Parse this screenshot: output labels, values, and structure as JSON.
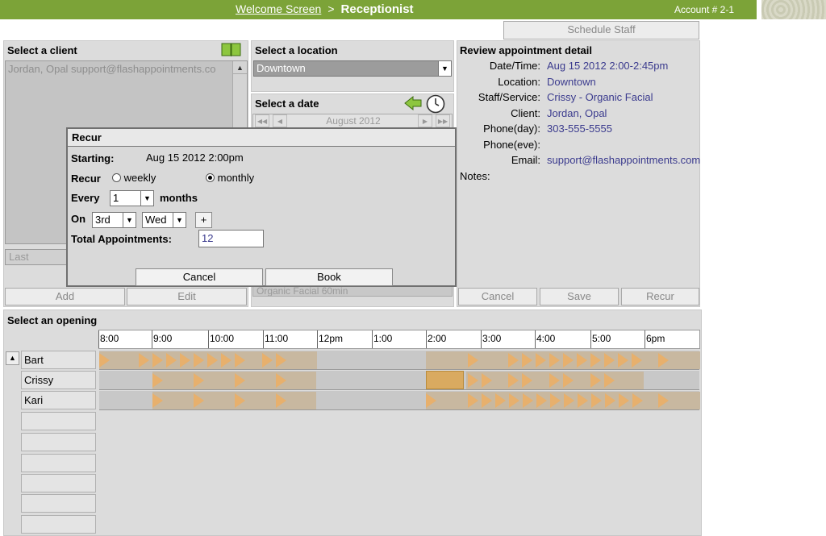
{
  "topbar": {
    "breadcrumb_link": "Welcome Screen",
    "separator": ">",
    "current": "Receptionist",
    "account": "Account # 2-1"
  },
  "schedule_staff_label": "Schedule Staff",
  "client_panel": {
    "title": "Select a client",
    "selected_client": "Jordan, Opal support@flashappointments.co",
    "last_placeholder": "Last",
    "add_label": "Add",
    "edit_label": "Edit",
    "book_icon": "book-icon"
  },
  "location_panel": {
    "title": "Select a location",
    "selected": "Downtown"
  },
  "date_panel": {
    "title": "Select a date",
    "month_label": "August  2012",
    "back_icon": "arrow-left-icon",
    "clock_icon": "clock-icon",
    "service_partial": "Organic Facial 60min"
  },
  "detail_panel": {
    "title": "Review appointment detail",
    "labels": {
      "datetime": "Date/Time:",
      "location": "Location:",
      "staff": "Staff/Service:",
      "client": "Client:",
      "phone_day": "Phone(day):",
      "phone_eve": "Phone(eve):",
      "email": "Email:",
      "notes": "Notes:"
    },
    "values": {
      "datetime": "Aug 15 2012 2:00-2:45pm",
      "location": "Downtown",
      "staff": "Crissy - Organic Facial",
      "client": "Jordan, Opal",
      "phone_day": "303-555-5555",
      "phone_eve": "",
      "email": "support@flashappointments.com"
    },
    "buttons": {
      "cancel": "Cancel",
      "save": "Save",
      "recur": "Recur"
    }
  },
  "opening": {
    "title": "Select an opening",
    "hours": [
      "8:00",
      "9:00",
      "10:00",
      "11:00",
      "12pm",
      "1:00",
      "2:00",
      "3:00",
      "4:00",
      "5:00",
      "6pm"
    ],
    "staff": [
      "Bart",
      "Crissy",
      "Kari"
    ],
    "collapse_icon": "caret-up-icon"
  },
  "dialog": {
    "title": "Recur",
    "starting_label": "Starting:",
    "starting_value": "Aug 15 2012 2:00pm",
    "recur_label": "Recur",
    "weekly_label": "weekly",
    "monthly_label": "monthly",
    "every_label": "Every",
    "every_value": "1",
    "months_label": "months",
    "on_label": "On",
    "on_ordinal": "3rd",
    "on_day": "Wed",
    "plus_label": "+",
    "total_label": "Total Appointments:",
    "total_value": "12",
    "cancel_label": "Cancel",
    "book_label": "Book"
  }
}
